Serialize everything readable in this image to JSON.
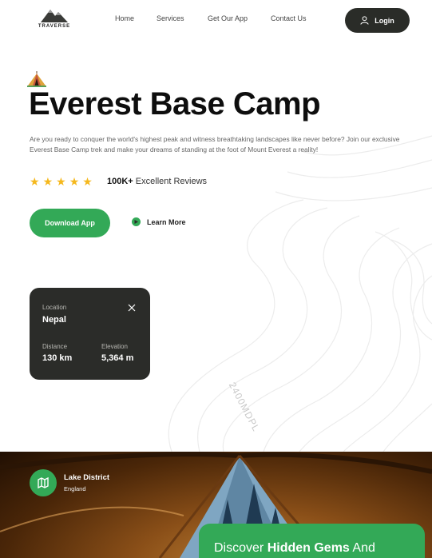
{
  "brand": {
    "name": "TRAVERSE",
    "icon": "mountain-logo-icon"
  },
  "nav": {
    "links": [
      "Home",
      "Services",
      "Get Our App",
      "Contact Us"
    ],
    "login_label": "Login",
    "login_icon": "user-icon"
  },
  "hero": {
    "icon": "camp-tent-icon",
    "title": "Everest Base Camp",
    "description": "Are you ready to conquer the world's highest peak and witness breathtaking landscapes like never before? Join our exclusive Everest Base Camp trek and make your dreams of standing at the foot of Mount Everest a reality!",
    "rating": {
      "stars": 5,
      "max": 5,
      "count": "100K+",
      "label": "Excellent Reviews"
    },
    "download_label": "Download App",
    "learn_more_label": "Learn More"
  },
  "info_card": {
    "location_label": "Location",
    "location_value": "Nepal",
    "distance_label": "Distance",
    "distance_value": "130 km",
    "elevation_label": "Elevation",
    "elevation_value": "5,364 m"
  },
  "contour_label": "2400MDPL",
  "feature": {
    "location_title": "Lake District",
    "location_subtitle": "England",
    "badge_icon": "map-icon",
    "discover_prefix": "Discover ",
    "discover_bold": "Hidden Gems",
    "discover_suffix": " And"
  },
  "colors": {
    "accent": "#33a957",
    "dark": "#2b2c29",
    "star": "#f5b81d"
  }
}
